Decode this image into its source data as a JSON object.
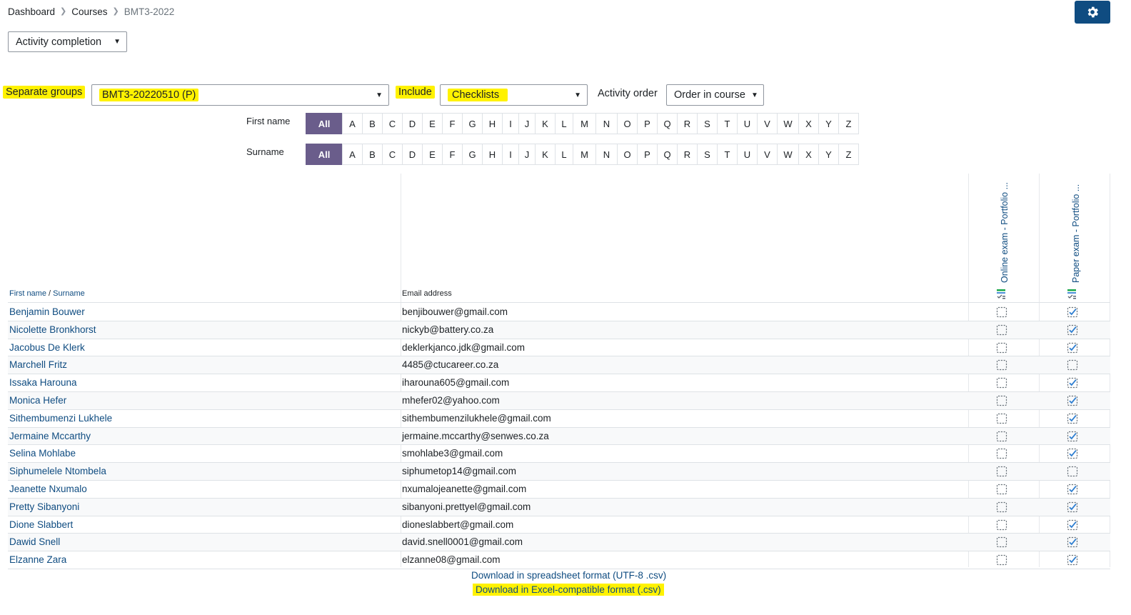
{
  "breadcrumb": [
    "Dashboard",
    "Courses",
    "BMT3-2022"
  ],
  "report_selector": {
    "selected": "Activity completion"
  },
  "filters": {
    "groups_label": "Separate groups",
    "groups_selected": "BMT3-20220510 (P)",
    "include_label": "Include",
    "include_selected": "Checklists",
    "order_label": "Activity order",
    "order_selected": "Order in course"
  },
  "initials": {
    "firstname_label": "First name",
    "surname_label": "Surname",
    "all_label": "All",
    "letters": [
      "A",
      "B",
      "C",
      "D",
      "E",
      "F",
      "G",
      "H",
      "I",
      "J",
      "K",
      "L",
      "M",
      "N",
      "O",
      "P",
      "Q",
      "R",
      "S",
      "T",
      "U",
      "V",
      "W",
      "X",
      "Y",
      "Z"
    ]
  },
  "table": {
    "col_first_name": "First name",
    "col_sep": " / ",
    "col_surname": "Surname",
    "col_email": "Email address",
    "activities": [
      "Online exam - Portfolio ...",
      "Paper exam - Portfolio ..."
    ],
    "rows": [
      {
        "name": "Benjamin Bouwer",
        "email": "benjibouwer@gmail.com",
        "done": [
          false,
          true
        ]
      },
      {
        "name": "Nicolette Bronkhorst",
        "email": "nickyb@battery.co.za",
        "done": [
          false,
          true
        ]
      },
      {
        "name": "Jacobus De Klerk",
        "email": "deklerkjanco.jdk@gmail.com",
        "done": [
          false,
          true
        ]
      },
      {
        "name": "Marchell Fritz",
        "email": "4485@ctucareer.co.za",
        "done": [
          false,
          false
        ]
      },
      {
        "name": "Issaka Harouna",
        "email": "iharouna605@gmail.com",
        "done": [
          false,
          true
        ]
      },
      {
        "name": "Monica Hefer",
        "email": "mhefer02@yahoo.com",
        "done": [
          false,
          true
        ]
      },
      {
        "name": "Sithembumenzi Lukhele",
        "email": "sithembumenzilukhele@gmail.com",
        "done": [
          false,
          true
        ]
      },
      {
        "name": "Jermaine Mccarthy",
        "email": "jermaine.mccarthy@senwes.co.za",
        "done": [
          false,
          true
        ]
      },
      {
        "name": "Selina Mohlabe",
        "email": "smohlabe3@gmail.com",
        "done": [
          false,
          true
        ]
      },
      {
        "name": "Siphumelele Ntombela",
        "email": "siphumetop14@gmail.com",
        "done": [
          false,
          false
        ]
      },
      {
        "name": "Jeanette Nxumalo",
        "email": "nxumalojeanette@gmail.com",
        "done": [
          false,
          true
        ]
      },
      {
        "name": "Pretty Sibanyoni",
        "email": "sibanyoni.prettyel@gmail.com",
        "done": [
          false,
          true
        ]
      },
      {
        "name": "Dione Slabbert",
        "email": "dioneslabbert@gmail.com",
        "done": [
          false,
          true
        ]
      },
      {
        "name": "Dawid Snell",
        "email": "david.snell0001@gmail.com",
        "done": [
          false,
          true
        ]
      },
      {
        "name": "Elzanne Zara",
        "email": "elzanne08@gmail.com",
        "done": [
          false,
          true
        ]
      }
    ]
  },
  "downloads": {
    "csv_utf8": "Download in spreadsheet format (UTF-8 .csv)",
    "csv_excel": "Download in Excel-compatible format (.csv)"
  },
  "icons": {
    "settings": "gear-icon",
    "activity_type": "checklist-icon",
    "incomplete": "checkbox-empty-icon",
    "complete": "checkbox-checked-icon"
  },
  "colors": {
    "accent": "#0f4c81",
    "all_button": "#6a5d8b",
    "highlight": "#fff200"
  }
}
